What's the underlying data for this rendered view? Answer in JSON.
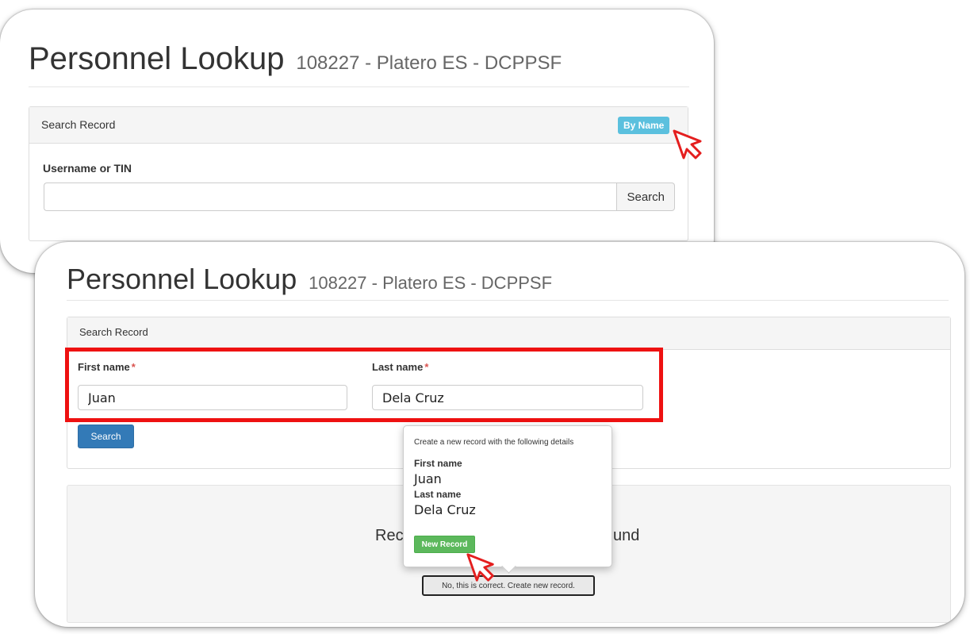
{
  "card1": {
    "title": "Personnel Lookup",
    "subtitle": "108227 - Platero ES - DCPPSF",
    "panel_heading": "Search Record",
    "mode_button": "By Name",
    "field_label": "Username or TIN",
    "field_value": "",
    "search_button": "Search"
  },
  "card2": {
    "title": "Personnel Lookup",
    "subtitle": "108227 - Platero ES - DCPPSF",
    "panel_heading": "Search Record",
    "first_name_label": "First name",
    "last_name_label": "Last name",
    "required_mark": "*",
    "first_name_value": "Juan",
    "last_name_value": "Dela Cruz",
    "search_button": "Search",
    "result_text_left": "Rec",
    "result_text_right": "und",
    "confirm_button": "No, this is correct. Create new record."
  },
  "popover": {
    "heading": "Create a new record with the following details",
    "first_name_label": "First name",
    "first_name_value": "Juan",
    "last_name_label": "Last name",
    "last_name_value": "Dela Cruz",
    "new_record_button": "New Record"
  },
  "colors": {
    "highlight": "#ee1111",
    "primary": "#337ab7",
    "info": "#5bc0de",
    "success": "#5cb85c"
  },
  "icons": [
    "cursor-pointer-icon"
  ]
}
